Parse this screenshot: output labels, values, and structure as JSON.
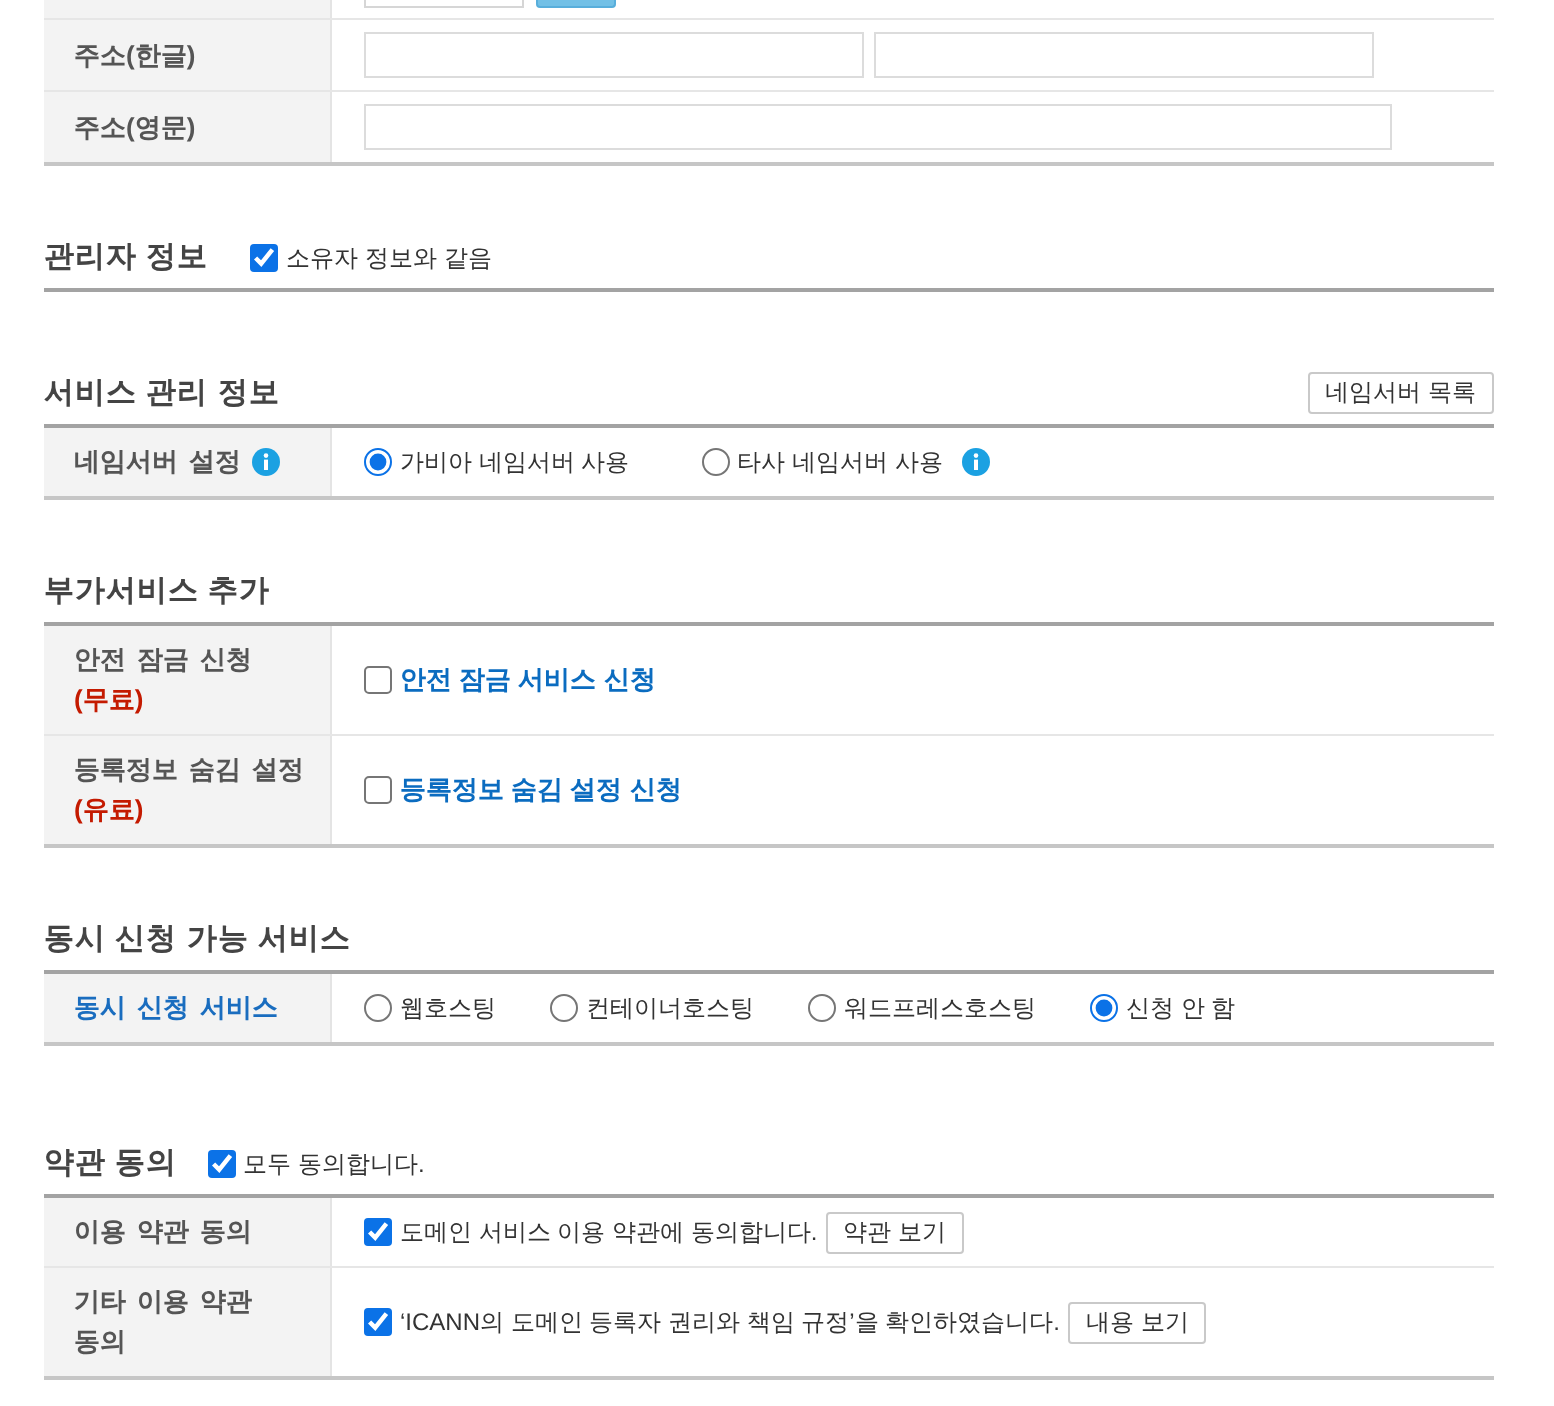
{
  "owner_table": {
    "rows": [
      {
        "kind": "cut_off"
      },
      {
        "kind": "two_fields",
        "label": "주소(한글)"
      },
      {
        "kind": "one_field",
        "label": "주소(영문)"
      }
    ]
  },
  "admin_info": {
    "title": "관리자 정보",
    "same_as_owner": {
      "label": "소유자 정보와 같음",
      "checked": true
    }
  },
  "service_info": {
    "title": "서비스 관리 정보",
    "button": "네임서버 목록",
    "rows": [
      {
        "label": "네임서버 설정",
        "info": true,
        "options": [
          {
            "label": "가비아 네임서버 사용",
            "selected": true,
            "info": false
          },
          {
            "label": "타사 네임서버 사용",
            "selected": false,
            "info": true
          }
        ]
      }
    ]
  },
  "addons": {
    "title": "부가서비스 추가",
    "rows": [
      {
        "label": "안전 잠금 신청",
        "note": "(무료)",
        "option": {
          "label": "안전 잠금 서비스 신청",
          "checked": false
        }
      },
      {
        "label": "등록정보 숨김 설정",
        "note": "(유료)",
        "option": {
          "label": "등록정보 숨김 설정 신청",
          "checked": false
        }
      }
    ]
  },
  "concurrent": {
    "title": "동시 신청 가능 서비스",
    "rows": [
      {
        "label": "동시 신청 서비스",
        "options": [
          {
            "label": "웹호스팅",
            "selected": false
          },
          {
            "label": "컨테이너호스팅",
            "selected": false
          },
          {
            "label": "워드프레스호스팅",
            "selected": false
          },
          {
            "label": "신청 안 함",
            "selected": true
          }
        ]
      }
    ]
  },
  "terms": {
    "title": "약관 동의",
    "agree_all": {
      "label": "모두 동의합니다.",
      "checked": true
    },
    "rows": [
      {
        "label": "이용 약관 동의",
        "agreement": {
          "label": "도메인 서비스 이용 약관에 동의합니다.",
          "checked": true
        },
        "button": "약관 보기"
      },
      {
        "label": "기타 이용 약관 동의",
        "agreement": {
          "label": "‘ICANN의 도메인 등록자 권리와 책임 규정’을 확인하였습니다.",
          "checked": true
        },
        "button": "내용 보기"
      }
    ]
  }
}
